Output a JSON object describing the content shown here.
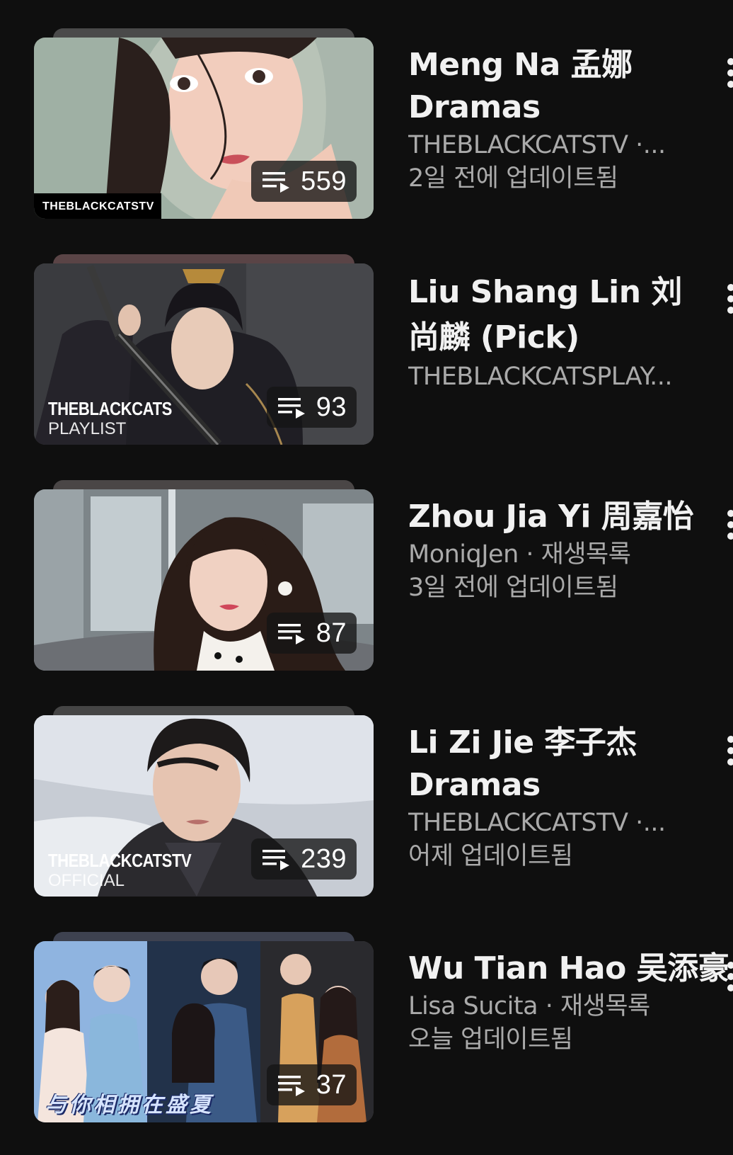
{
  "playlists": [
    {
      "title": "Meng Na 孟娜 Dramas",
      "channel_line": "THEBLACKCATSTV ·...",
      "updated": "2일 전에 업데이트됨",
      "count": "559",
      "watermark": "THEBLACKCATSTV",
      "stack_color": "#4a4a4a"
    },
    {
      "title": "Liu Shang Lin 刘尚麟 (Pick)",
      "channel_line": "THEBLACKCATSPLAY...",
      "updated": "",
      "count": "93",
      "watermark_line1": "THEBLACKCATS",
      "watermark_line2": "PLAYLIST",
      "stack_color": "#5a4446"
    },
    {
      "title": "Zhou Jia Yi 周嘉怡",
      "channel_line": "MoniqJen · 재생목록",
      "updated": "3일 전에 업데이트됨",
      "count": "87",
      "stack_color": "#4a4646"
    },
    {
      "title": "Li Zi Jie 李子杰 Dramas",
      "channel_line": "THEBLACKCATSTV ·...",
      "updated": "어제 업데이트됨",
      "count": "239",
      "watermark_line1": "THEBLACKCATSTV",
      "watermark_line2": "OFFICIAL",
      "stack_color": "#454545"
    },
    {
      "title": "Wu Tian Hao 吴添豪",
      "channel_line": "Lisa Sucita · 재생목록",
      "updated": "오늘 업데이트됨",
      "count": "37",
      "caption": "与你相拥在盛夏",
      "stack_color": "#3e4250"
    }
  ]
}
